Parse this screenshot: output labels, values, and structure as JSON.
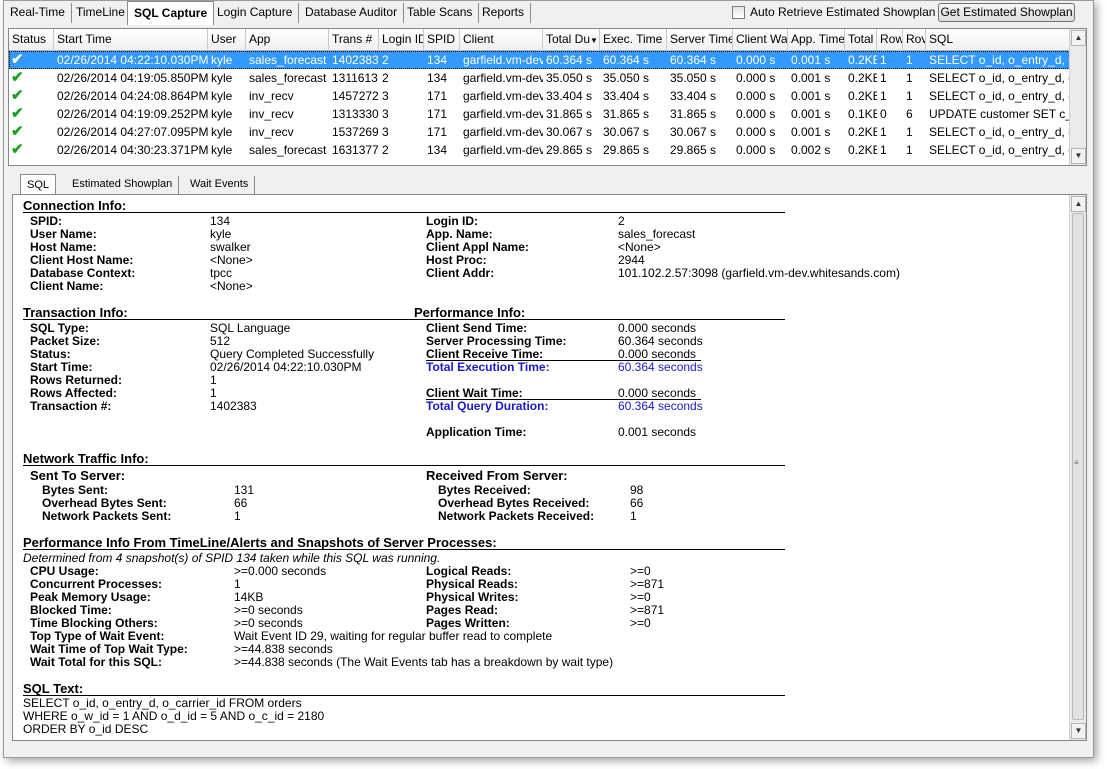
{
  "top_tabs": [
    "Real-Time",
    "TimeLine",
    "SQL Capture",
    "Login Capture",
    "Database Auditor",
    "Table Scans",
    "Reports"
  ],
  "active_tab": "SQL Capture",
  "auto_retrieve_label": "Auto Retrieve Estimated Showplan",
  "get_showplan_label": "Get Estimated Showplan",
  "grid": {
    "columns": [
      "Status",
      "Start Time",
      "User",
      "App",
      "Trans #",
      "Login ID",
      "SPID",
      "Client",
      "Total Du",
      "Exec. Time",
      "Server Time",
      "Client Wa",
      "App. Time",
      "Total",
      "Row",
      "Rov",
      "SQL"
    ],
    "rows": [
      [
        "2",
        "02/26/2014 04:22:10.030PM",
        "kyle",
        "sales_forecast",
        "1402383",
        "2",
        "134",
        "garfield.vm-dev",
        "60.364 s",
        "60.364 s",
        "60.364 s",
        "0.000 s",
        "0.001 s",
        "0.2KB",
        "1",
        "1",
        "SELECT o_id, o_entry_d, o_"
      ],
      [
        "2",
        "02/26/2014 04:19:05.850PM",
        "kyle",
        "sales_forecast",
        "1311613",
        "2",
        "134",
        "garfield.vm-dev",
        "35.050 s",
        "35.050 s",
        "35.050 s",
        "0.000 s",
        "0.001 s",
        "0.2KB",
        "1",
        "1",
        "SELECT o_id, o_entry_d, o_c"
      ],
      [
        "2",
        "02/26/2014 04:24:08.864PM",
        "kyle",
        "inv_recv",
        "1457272",
        "3",
        "171",
        "garfield.vm-dev",
        "33.404 s",
        "33.404 s",
        "33.404 s",
        "0.000 s",
        "0.001 s",
        "0.2KB",
        "1",
        "1",
        "SELECT o_id, o_entry_d, o_c"
      ],
      [
        "2",
        "02/26/2014 04:19:09.252PM",
        "kyle",
        "inv_recv",
        "1313330",
        "3",
        "171",
        "garfield.vm-dev",
        "31.865 s",
        "31.865 s",
        "31.865 s",
        "0.000 s",
        "0.001 s",
        "0.1KB",
        "0",
        "6",
        "UPDATE customer SET c_cr"
      ],
      [
        "2",
        "02/26/2014 04:27:07.095PM",
        "kyle",
        "inv_recv",
        "1537269",
        "3",
        "171",
        "garfield.vm-dev",
        "30.067 s",
        "30.067 s",
        "30.067 s",
        "0.000 s",
        "0.001 s",
        "0.2KB",
        "1",
        "1",
        "SELECT o_id, o_entry_d, o_c"
      ],
      [
        "2",
        "02/26/2014 04:30:23.371PM",
        "kyle",
        "sales_forecast",
        "1631377",
        "2",
        "134",
        "garfield.vm-dev",
        "29.865 s",
        "29.865 s",
        "29.865 s",
        "0.000 s",
        "0.002 s",
        "0.2KB",
        "1",
        "1",
        "SELECT o_id, o_entry_d, o_c"
      ]
    ]
  },
  "sub_tabs": [
    "SQL",
    "Estimated Showplan",
    "Wait Events"
  ],
  "connection": {
    "title": "Connection Info:",
    "spid_l": "SPID:",
    "spid": "134",
    "user_l": "User Name:",
    "user": "kyle",
    "host_l": "Host Name:",
    "host": "swalker",
    "chost_l": "Client Host Name:",
    "chost": "<None>",
    "db_l": "Database Context:",
    "db": "tpcc",
    "cname_l": "Client Name:",
    "cname": "<None>",
    "login_l": "Login ID:",
    "login": "2",
    "app_l": "App. Name:",
    "app": "sales_forecast",
    "capp_l": "Client Appl Name:",
    "capp": "<None>",
    "hproc_l": "Host Proc:",
    "hproc": "2944",
    "caddr_l": "Client Addr:",
    "caddr": "101.102.2.57:3098 (garfield.vm-dev.whitesands.com)"
  },
  "transaction": {
    "title": "Transaction Info:",
    "type_l": "SQL Type:",
    "type": "SQL Language",
    "packet_l": "Packet Size:",
    "packet": "512",
    "status_l": "Status:",
    "status": "Query Completed Successfully",
    "start_l": "Start Time:",
    "start": "02/26/2014 04:22:10.030PM",
    "rows_l": "Rows Returned:",
    "rows": "1",
    "affected_l": "Rows Affected:",
    "affected": "1",
    "trans_l": "Transaction #:",
    "trans": "1402383"
  },
  "performance": {
    "title": "Performance Info:",
    "send_l": "Client Send Time:",
    "send": "0.000 seconds",
    "proc_l": "Server Processing Time:",
    "proc": "60.364 seconds",
    "recv_l": "Client Receive Time:",
    "recv": "0.000 seconds",
    "exec_l": "Total Execution Time:",
    "exec": "60.364 seconds",
    "wait_l": "Client Wait Time:",
    "wait": "0.000 seconds",
    "dur_l": "Total Query Duration:",
    "dur": "60.364 seconds",
    "app_l": "Application Time:",
    "app": "0.001 seconds"
  },
  "network": {
    "title": "Network Traffic Info:",
    "sent_title": "Sent To Server:",
    "bytes_sent_l": "Bytes Sent:",
    "bytes_sent": "131",
    "ovh_sent_l": "Overhead Bytes Sent:",
    "ovh_sent": "66",
    "pk_sent_l": "Network Packets Sent:",
    "pk_sent": "1",
    "recv_title": "Received From Server:",
    "bytes_recv_l": "Bytes Received:",
    "bytes_recv": "98",
    "ovh_recv_l": "Overhead Bytes Received:",
    "ovh_recv": "66",
    "pk_recv_l": "Network Packets Received:",
    "pk_recv": "1"
  },
  "snapshots": {
    "title": "Performance Info From TimeLine/Alerts and Snapshots of Server Processes:",
    "note": "Determined from 4 snapshot(s) of SPID 134 taken while this SQL was running.",
    "cpu_l": "CPU Usage:",
    "cpu": ">=0.000 seconds",
    "conc_l": "Concurrent Processes:",
    "conc": "1",
    "mem_l": "Peak Memory Usage:",
    "mem": "14KB",
    "blk_l": "Blocked Time:",
    "blk": ">=0 seconds",
    "tbo_l": "Time Blocking Others:",
    "tbo": ">=0 seconds",
    "top_l": "Top Type of Wait Event:",
    "top": "Wait Event ID 29, waiting for regular buffer read to complete",
    "wtt_l": "Wait Time of Top Wait Type:",
    "wtt": ">=44.838 seconds",
    "wts_l": "Wait Total for this SQL:",
    "wts": ">=44.838 seconds (The Wait Events tab has a breakdown by wait type)",
    "lr_l": "Logical Reads:",
    "lr": ">=0",
    "pr_l": "Physical Reads:",
    "pr": ">=871",
    "pw_l": "Physical Writes:",
    "pw": ">=0",
    "pgr_l": "Pages Read:",
    "pgr": ">=871",
    "pgw_l": "Pages Written:",
    "pgw": ">=0"
  },
  "sql_text": {
    "title": "SQL Text:",
    "line1": "SELECT o_id, o_entry_d, o_carrier_id FROM orders",
    "line2": "WHERE o_w_id = 1 AND o_d_id = 5 AND o_c_id = 2180",
    "line3": "ORDER BY o_id DESC"
  }
}
